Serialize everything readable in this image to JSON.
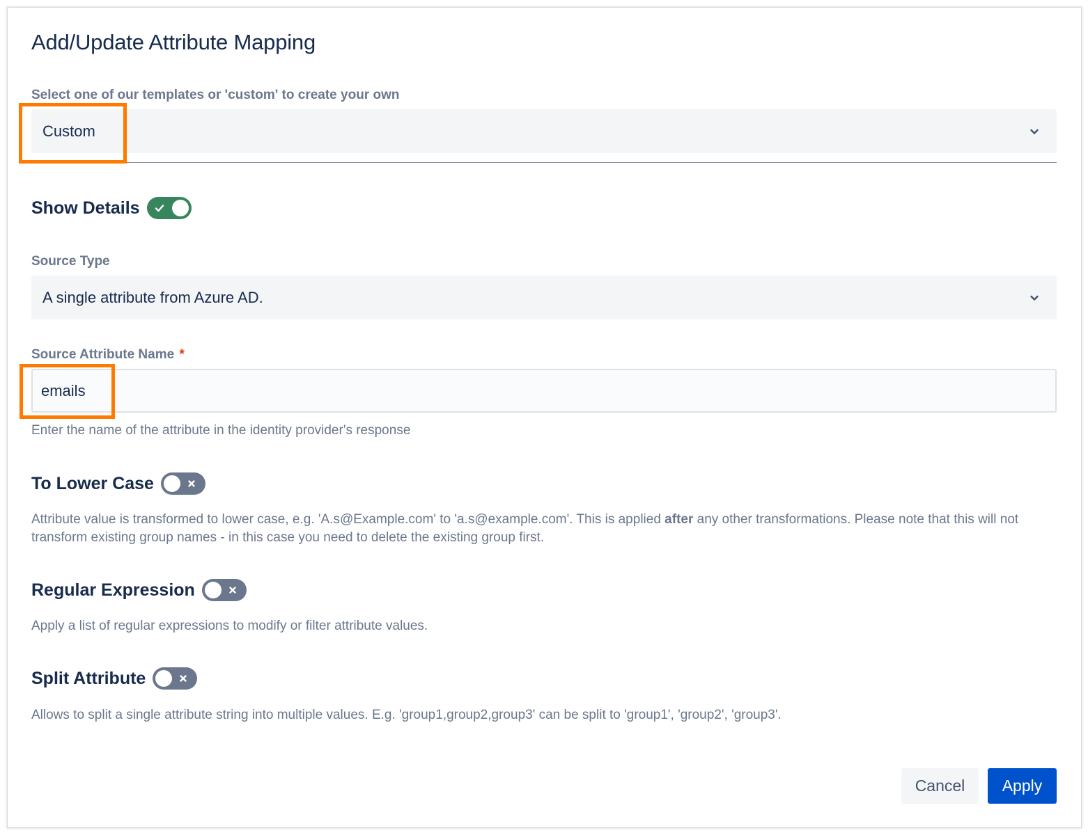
{
  "dialog": {
    "title": "Add/Update Attribute Mapping"
  },
  "template": {
    "label": "Select one of our templates or 'custom' to create your own",
    "value": "Custom"
  },
  "show_details": {
    "label": "Show Details",
    "enabled": true
  },
  "source_type": {
    "label": "Source Type",
    "value": "A single attribute from Azure AD."
  },
  "source_attribute": {
    "label": "Source Attribute Name",
    "required_marker": "*",
    "value": "emails",
    "helper": "Enter the name of the attribute in the identity provider's response"
  },
  "to_lower_case": {
    "label": "To Lower Case",
    "enabled": false,
    "description_before": "Attribute value is transformed to lower case, e.g. 'A.s@Example.com' to 'a.s@example.com'. This is applied ",
    "description_bold": "after",
    "description_after": " any other transformations. Please note that this will not transform existing group names - in this case you need to delete the existing group first."
  },
  "regular_expression": {
    "label": "Regular Expression",
    "enabled": false,
    "description": "Apply a list of regular expressions to modify or filter attribute values."
  },
  "split_attribute": {
    "label": "Split Attribute",
    "enabled": false,
    "description": "Allows to split a single attribute string into multiple values. E.g. 'group1,group2,group3' can be split to 'group1', 'group2', 'group3'."
  },
  "actions": {
    "cancel_label": "Cancel",
    "apply_label": "Apply"
  },
  "icons": {
    "select_chevron": "chevron-down-icon",
    "toggle_on": "check-icon",
    "toggle_off": "cross-icon"
  },
  "colors": {
    "highlight": "#ff7a00",
    "toggle_on": "#36855c",
    "toggle_off": "#6b778c",
    "primary_button": "#0052cc"
  }
}
